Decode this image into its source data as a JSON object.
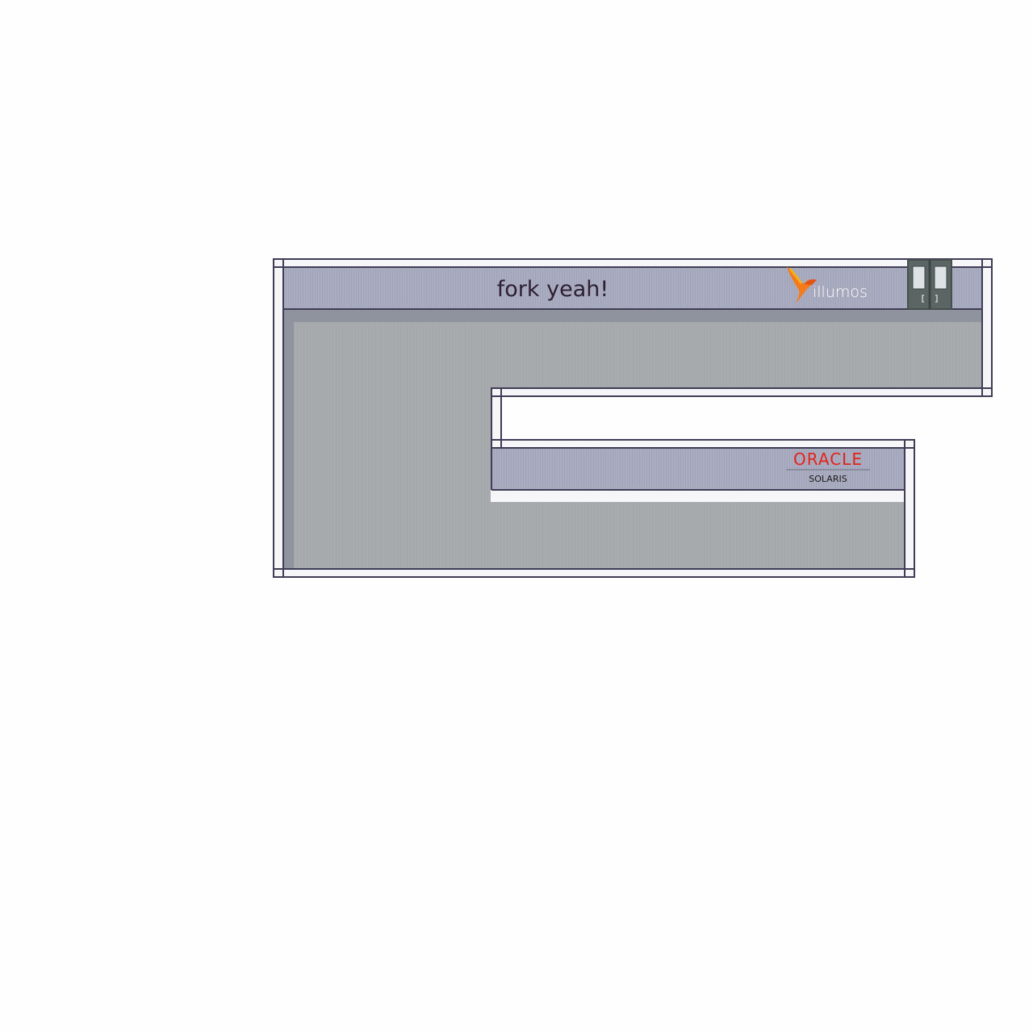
{
  "scene": {
    "banner_text": "fork yeah!",
    "illumos_logo_text": "illumos",
    "oracle_logo_text": "ORACLE",
    "solaris_logo_text": "SOLARIS",
    "door_icon": "double-door-icon",
    "colors": {
      "wall_outline": "#3f3c56",
      "wall_fill": "#f6f5f8",
      "wall_face": "#aaacc0",
      "floor": "#a7abae",
      "floor_shadow": "#8f939d",
      "door": "#5b6664",
      "door_window": "#dde3e5",
      "illumos_bird": "#f57a1b",
      "oracle_red": "#e2241b"
    }
  }
}
